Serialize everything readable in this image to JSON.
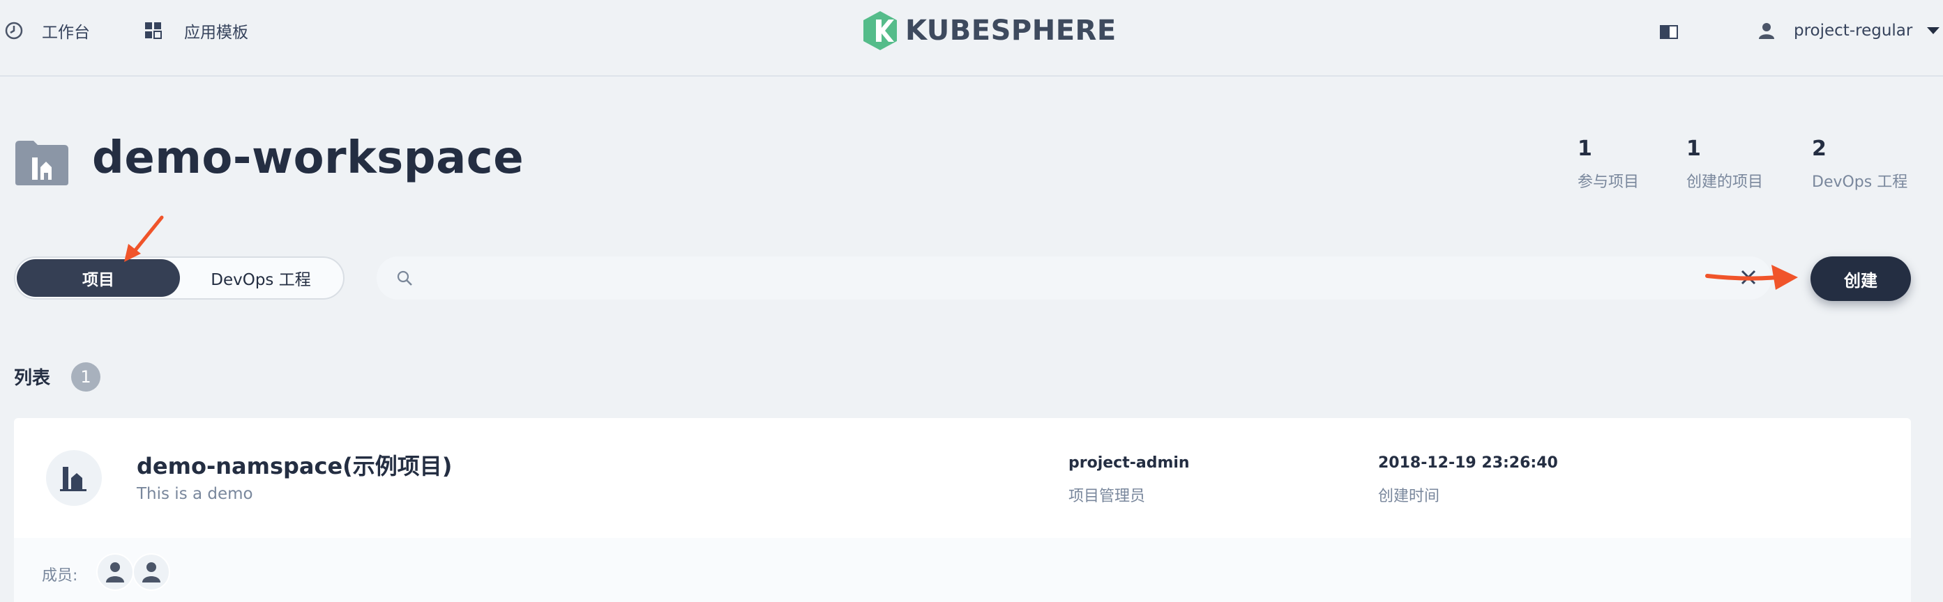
{
  "nav": {
    "workbench": "工作台",
    "app_templates": "应用模板",
    "brand": "KUBESPHERE",
    "username": "project-regular"
  },
  "workspace": {
    "name": "demo-workspace",
    "stats": [
      {
        "value": "1",
        "label": "参与项目"
      },
      {
        "value": "1",
        "label": "创建的项目"
      },
      {
        "value": "2",
        "label": "DevOps 工程"
      }
    ]
  },
  "toolbar": {
    "tabs": [
      {
        "label": "项目",
        "active": true
      },
      {
        "label": "DevOps 工程",
        "active": false
      }
    ],
    "search_placeholder": "",
    "create_label": "创建"
  },
  "list": {
    "title": "列表",
    "count": "1",
    "items": [
      {
        "name": "demo-namspace(示例项目)",
        "description": "This is a demo",
        "creator": "project-admin",
        "creator_label": "项目管理员",
        "created_at": "2018-12-19 23:26:40",
        "created_label": "创建时间",
        "members_label": "成员:",
        "member_count": 2
      }
    ]
  },
  "colors": {
    "primary_dark": "#242e42",
    "brand_green": "#55bc8a",
    "annotation_arrow": "#f0542a",
    "background": "#eff2f5"
  },
  "icons": [
    "clock-icon",
    "grid-icon",
    "kubesphere-logo-icon",
    "docs-icon",
    "user-icon",
    "caret-down-icon",
    "workspace-folder-icon",
    "search-icon",
    "clear-icon",
    "project-icon",
    "member-avatar-icon"
  ]
}
